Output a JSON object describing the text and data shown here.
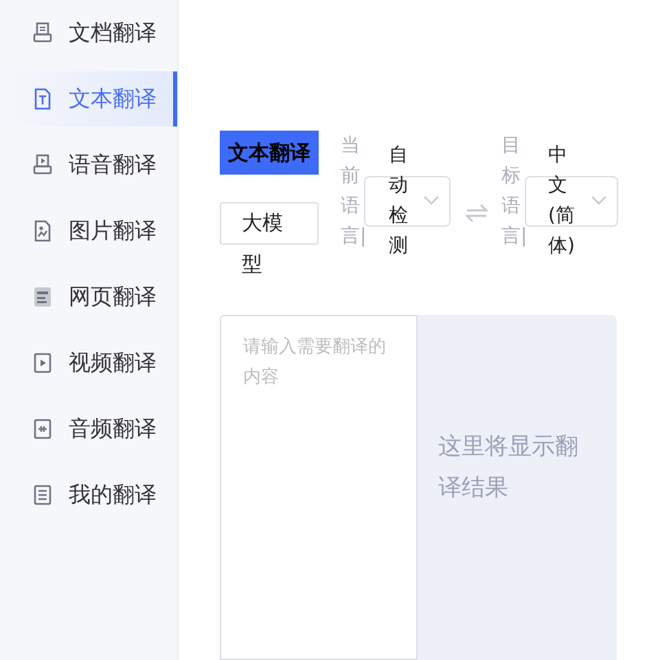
{
  "sidebar": {
    "items": [
      {
        "label": "文档翻译",
        "selected": false
      },
      {
        "label": "文本翻译",
        "selected": true
      },
      {
        "label": "语音翻译",
        "selected": false
      },
      {
        "label": "图片翻译",
        "selected": false
      },
      {
        "label": "网页翻译",
        "selected": false
      },
      {
        "label": "视频翻译",
        "selected": false
      },
      {
        "label": "音频翻译",
        "selected": false
      },
      {
        "label": "我的翻译",
        "selected": false
      }
    ]
  },
  "mode_tab": {
    "label": "文本翻译",
    "selected": true
  },
  "model_button": {
    "label": "大模型"
  },
  "source_language": {
    "label": "当前语言|",
    "value": "自动检测"
  },
  "target_language": {
    "label": "目标语言|",
    "value": "中文(简体)"
  },
  "input": {
    "placeholder": "请输入需要翻译的内容"
  },
  "output": {
    "placeholder": "这里将显示翻译结果"
  }
}
